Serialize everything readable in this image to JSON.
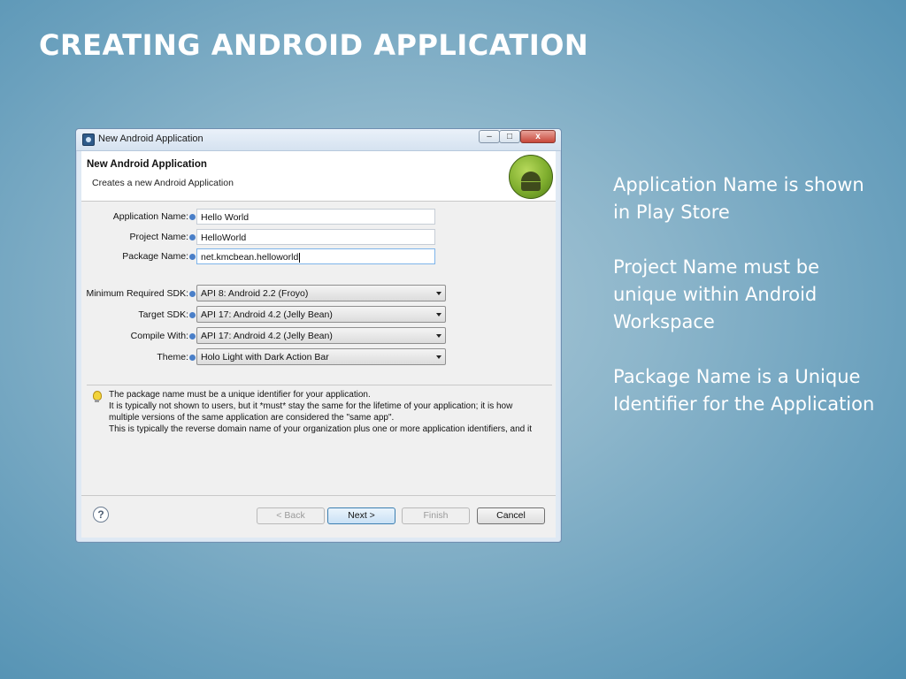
{
  "slide": {
    "title": "CREATING ANDROID APPLICATION",
    "notes": [
      "Application Name is shown in Play Store",
      "Project Name must be unique within Android Workspace",
      "Package Name is a Unique Identifier for the Application"
    ]
  },
  "window": {
    "title": "New Android Application",
    "controls": {
      "minimize": "–",
      "maximize": "□",
      "close": "x"
    }
  },
  "header": {
    "title": "New Android Application",
    "subtitle": "Creates a new Android Application",
    "logo_icon": "android-logo-icon"
  },
  "form": {
    "application_name": {
      "label": "Application Name:",
      "value": "Hello World"
    },
    "project_name": {
      "label": "Project Name:",
      "value": "HelloWorld"
    },
    "package_name": {
      "label": "Package Name:",
      "value": "net.kmcbean.helloworld"
    },
    "min_sdk": {
      "label": "Minimum Required SDK:",
      "value": "API 8: Android 2.2 (Froyo)"
    },
    "target_sdk": {
      "label": "Target SDK:",
      "value": "API 17: Android 4.2 (Jelly Bean)"
    },
    "compile_with": {
      "label": "Compile With:",
      "value": "API 17: Android 4.2 (Jelly Bean)"
    },
    "theme": {
      "label": "Theme:",
      "value": "Holo Light with Dark Action Bar"
    }
  },
  "info": {
    "lines": [
      "The package name must be a unique identifier for your application.",
      "It is typically not shown to users, but it *must* stay the same for the lifetime of your application; it is how",
      "multiple versions of the same application are considered the \"same app\".",
      "This is typically the reverse domain name of your organization plus one or more application identifiers, and it"
    ]
  },
  "buttons": {
    "help": "?",
    "back": "< Back",
    "next": "Next >",
    "finish": "Finish",
    "cancel": "Cancel"
  }
}
